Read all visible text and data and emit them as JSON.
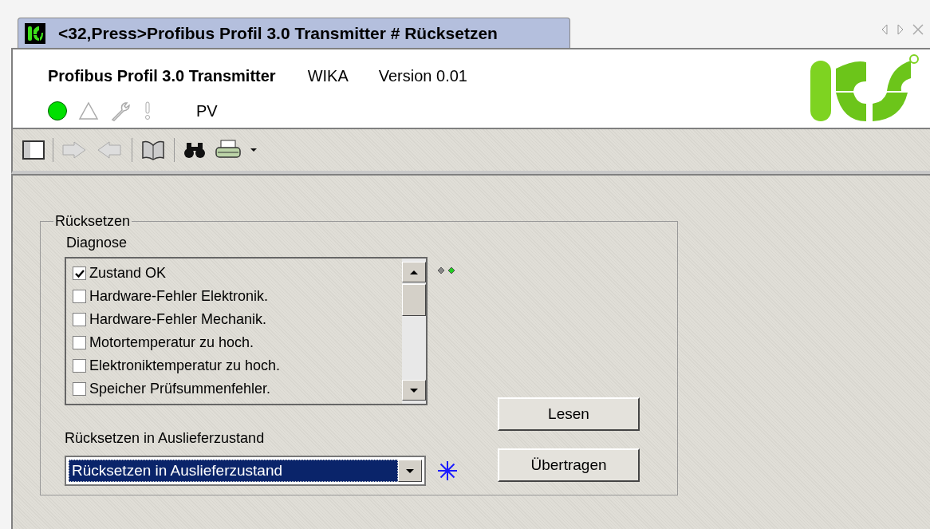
{
  "tab": {
    "title": "<32,Press>Profibus Profil 3.0 Transmitter # Rücksetzen",
    "selected": true
  },
  "header": {
    "device": "Profibus Profil 3.0 Transmitter",
    "manufacturer": "WIKA",
    "version": "Version 0.01",
    "status_label": "PV"
  },
  "group": {
    "legend": "Rücksetzen",
    "diagnose": {
      "label": "Diagnose",
      "items": [
        {
          "label": "Zustand OK",
          "checked": true
        },
        {
          "label": "Hardware-Fehler Elektronik.",
          "checked": false
        },
        {
          "label": "Hardware-Fehler Mechanik.",
          "checked": false
        },
        {
          "label": "Motortemperatur zu hoch.",
          "checked": false
        },
        {
          "label": "Elektroniktemperatur zu hoch.",
          "checked": false
        },
        {
          "label": "Speicher Prüfsummenfehler.",
          "checked": false
        }
      ]
    },
    "reset": {
      "label": "Rücksetzen in Auslieferzustand",
      "value": "Rücksetzen in Auslieferzustand"
    },
    "buttons": [
      "Lesen",
      "Übertragen"
    ]
  }
}
